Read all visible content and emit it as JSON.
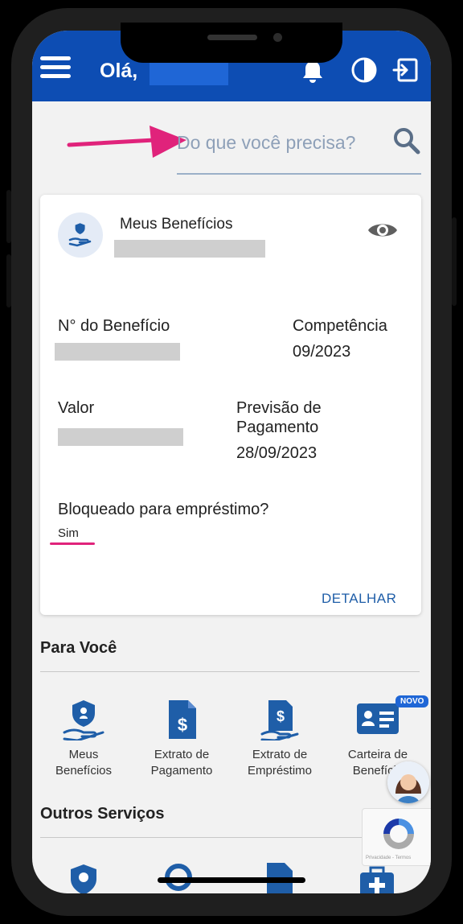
{
  "header": {
    "greeting": "Olá,",
    "icons": [
      "menu-icon",
      "bell-icon",
      "contrast-icon",
      "logout-icon"
    ],
    "color": "#0d4db3"
  },
  "search": {
    "placeholder": "Do que você precisa?"
  },
  "card": {
    "title": "Meus Benefícios",
    "benefit_number_label": "N° do Benefício",
    "competence_label": "Competência",
    "competence_value": "09/2023",
    "value_label": "Valor",
    "payment_label_line1": "Previsão de",
    "payment_label_line2": "Pagamento",
    "payment_value": "28/09/2023",
    "blocked_label": "Bloqueado para empréstimo?",
    "blocked_value": "Sim",
    "detail_link": "DETALHAR"
  },
  "para_voce": {
    "title": "Para Você",
    "items": [
      {
        "line1": "Meus",
        "line2": "Benefícios"
      },
      {
        "line1": "Extrato de",
        "line2": "Pagamento"
      },
      {
        "line1": "Extrato de",
        "line2": "Empréstimo"
      },
      {
        "line1": "Carteira de",
        "line2": "Benefício"
      }
    ],
    "badge": "NOVO"
  },
  "outros": {
    "title": "Outros Serviços"
  },
  "recaptcha": {
    "text": "Privacidade - Termos"
  },
  "colors": {
    "brand": "#0d4db3",
    "annotation": "#e0237b",
    "link": "#1f5ea8"
  }
}
